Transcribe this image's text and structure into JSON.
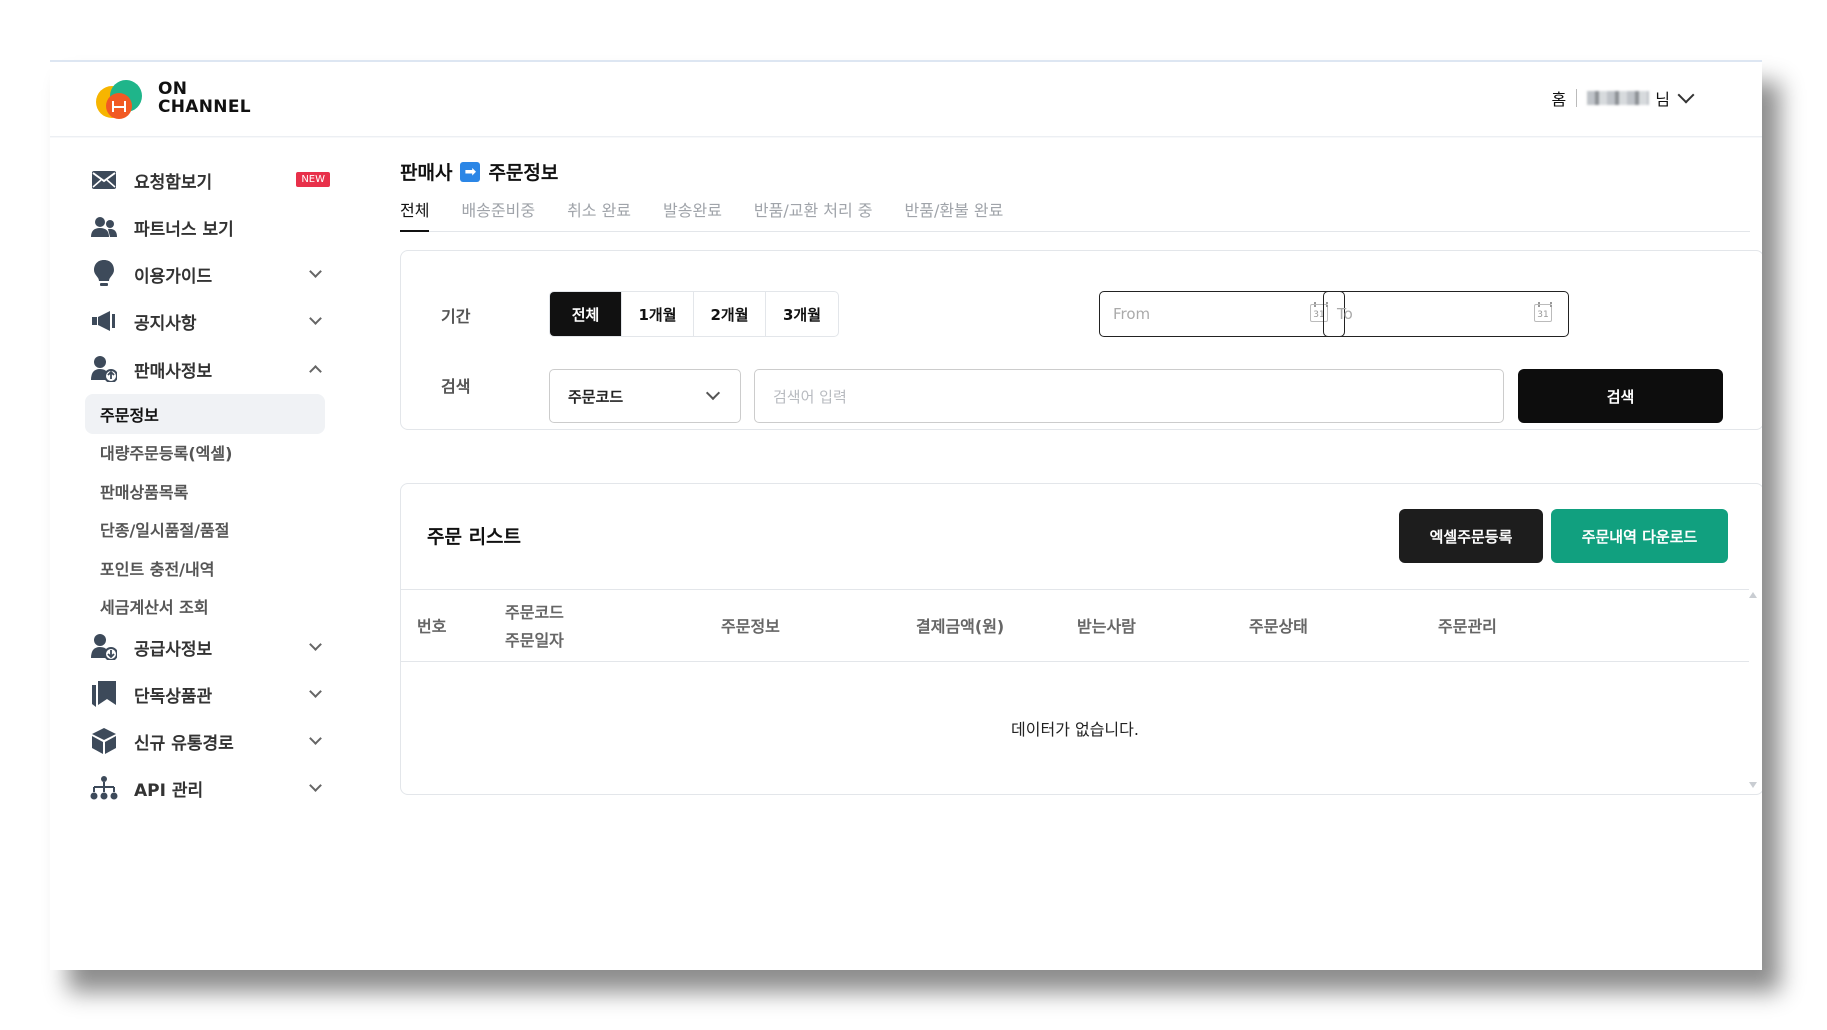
{
  "brand": {
    "line1": "ON",
    "line2": "CHANNEL"
  },
  "header": {
    "home": "홈",
    "user_suffix": "님"
  },
  "sidebar": {
    "items": [
      {
        "label": "요청함보기",
        "badge": "NEW",
        "icon": "envelope-icon"
      },
      {
        "label": "파트너스 보기",
        "icon": "users-icon"
      },
      {
        "label": "이용가이드",
        "icon": "lightbulb-icon"
      },
      {
        "label": "공지사항",
        "icon": "megaphone-icon"
      },
      {
        "label": "판매사정보",
        "icon": "seller-icon"
      },
      {
        "label": "공급사정보",
        "icon": "supplier-icon"
      },
      {
        "label": "단독상품관",
        "icon": "bookmark-icon"
      },
      {
        "label": "신규 유통경로",
        "icon": "box-icon"
      },
      {
        "label": "API 관리",
        "icon": "sitemap-icon"
      }
    ],
    "sub_items": [
      "주문정보",
      "대량주문등록(엑셀)",
      "판매상품목록",
      "단종/일시품절/품절",
      "포인트 충전/내역",
      "세금계산서 조회"
    ]
  },
  "breadcrumb": {
    "parent": "판매사",
    "arrow": "➡",
    "current": "주문정보"
  },
  "tabs": [
    "전체",
    "배송준비중",
    "취소 완료",
    "발송완료",
    "반품/교환 처리 중",
    "반품/환불 완료"
  ],
  "filter": {
    "period_label": "기간",
    "periods": [
      "전체",
      "1개월",
      "2개월",
      "3개월"
    ],
    "from_placeholder": "From",
    "to_placeholder": "To",
    "calendar_day": "31",
    "search_label": "검색",
    "search_type": "주문코드",
    "search_placeholder": "검색어 입력",
    "search_button": "검색"
  },
  "order_list": {
    "title": "주문 리스트",
    "excel_button": "엑셀주문등록",
    "download_button": "주문내역 다운로드",
    "columns": [
      "번호",
      "주문코드",
      "주문일자",
      "주문정보",
      "결제금액(원)",
      "받는사람",
      "주문상태",
      "주문관리"
    ],
    "empty_message": "데이터가 없습니다."
  },
  "colors": {
    "accent_green": "#11a07f",
    "badge_red": "#e8304a",
    "arrow_blue": "#2b86e6"
  }
}
